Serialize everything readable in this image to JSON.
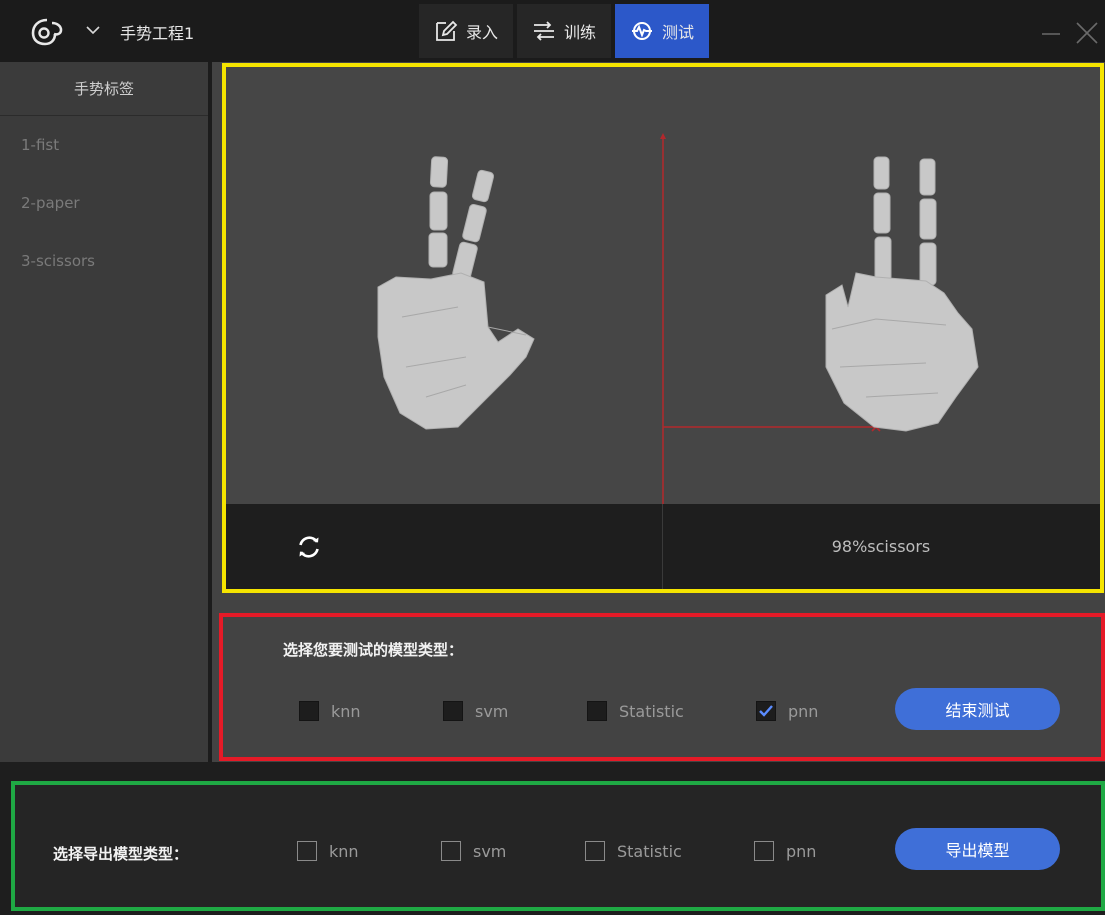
{
  "titlebar": {
    "project_name": "手势工程1",
    "tabs": [
      {
        "label": "录入",
        "icon": "edit-icon",
        "active": false
      },
      {
        "label": "训练",
        "icon": "train-icon",
        "active": false
      },
      {
        "label": "测试",
        "icon": "test-icon",
        "active": true
      }
    ]
  },
  "sidebar": {
    "header": "手势标签",
    "items": [
      {
        "label": "1-fist"
      },
      {
        "label": "2-paper"
      },
      {
        "label": "3-scissors"
      }
    ]
  },
  "visualizer": {
    "result_percent": "98%",
    "result_label": "scissors"
  },
  "test_panel": {
    "title": "选择您要测试的模型类型：",
    "options": [
      {
        "label": "knn",
        "checked": false
      },
      {
        "label": "svm",
        "checked": false
      },
      {
        "label": "Statistic",
        "checked": false
      },
      {
        "label": "pnn",
        "checked": true
      }
    ],
    "button_label": "结束测试"
  },
  "export_panel": {
    "title": "选择导出模型类型：",
    "options": [
      {
        "label": "knn",
        "checked": false
      },
      {
        "label": "svm",
        "checked": false
      },
      {
        "label": "Statistic",
        "checked": false
      },
      {
        "label": "pnn",
        "checked": false
      }
    ],
    "button_label": "导出模型"
  },
  "colors": {
    "accent": "#3f6fd8",
    "tab_active": "#2c58c9",
    "highlight_visualizer": "#f5e400",
    "highlight_test": "#e51a27",
    "highlight_export": "#1fa944",
    "axis": "#b3282c"
  }
}
